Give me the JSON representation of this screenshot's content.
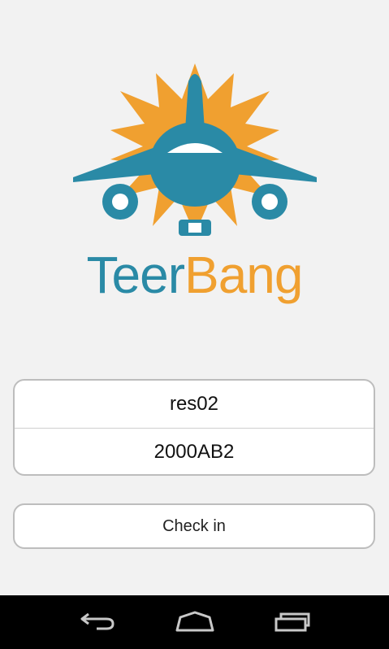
{
  "brand": {
    "part1": "Teer",
    "part2": "Bang",
    "colors": {
      "teal": "#2a8aa6",
      "orange": "#f0a030"
    }
  },
  "form": {
    "username_value": "res02",
    "code_value": "2000AB2"
  },
  "actions": {
    "checkin_label": "Check in"
  },
  "navbar": {
    "back_icon": "back-icon",
    "home_icon": "home-icon",
    "recent_icon": "recent-apps-icon"
  }
}
